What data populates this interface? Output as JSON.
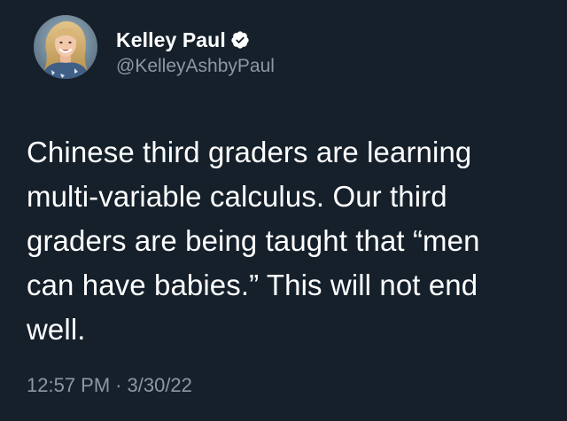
{
  "tweet": {
    "author": {
      "display_name": "Kelley Paul",
      "handle": "@KelleyAshbyPaul",
      "verified": true,
      "avatar_icon": "profile-photo"
    },
    "text": "Chinese third graders are learning\nmulti-variable calculus.  Our third\ngraders are being taught that “men\ncan have babies.”  This will not end\nwell.",
    "time": "12:57 PM",
    "separator": "·",
    "date": "3/30/22"
  },
  "colors": {
    "background": "#15202b",
    "primary_text": "#ffffff",
    "secondary_text": "#8b98a5",
    "verified_badge": "#ffffff"
  }
}
